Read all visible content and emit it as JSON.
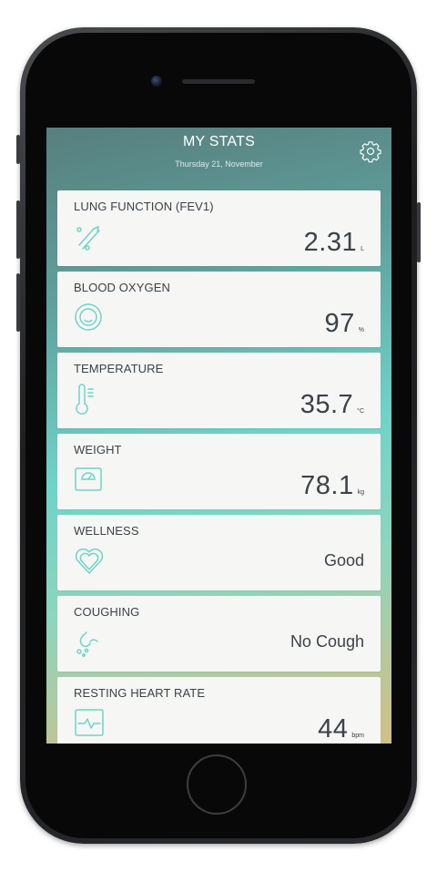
{
  "header": {
    "title": "MY STATS",
    "date": "Thursday 21, November"
  },
  "colors": {
    "accent": "#6fd3c8",
    "text": "#3b4248",
    "card": "#f6f6f5"
  },
  "stats": [
    {
      "label": "LUNG FUNCTION (FEV1)",
      "value": "2.31",
      "unit": "L",
      "icon": "lungs-icon"
    },
    {
      "label": "BLOOD OXYGEN",
      "value": "97",
      "unit": "%",
      "icon": "oxygen-icon"
    },
    {
      "label": "TEMPERATURE",
      "value": "35.7",
      "unit": "°C",
      "icon": "thermometer-icon"
    },
    {
      "label": "WEIGHT",
      "value": "78.1",
      "unit": "kg",
      "icon": "scale-icon"
    },
    {
      "label": "WELLNESS",
      "value": "Good",
      "unit": "",
      "icon": "heart-icon"
    },
    {
      "label": "COUGHING",
      "value": "No Cough",
      "unit": "",
      "icon": "cough-icon"
    },
    {
      "label": "RESTING HEART RATE",
      "value": "44",
      "unit": "bpm",
      "icon": "heart-rate-icon"
    }
  ]
}
